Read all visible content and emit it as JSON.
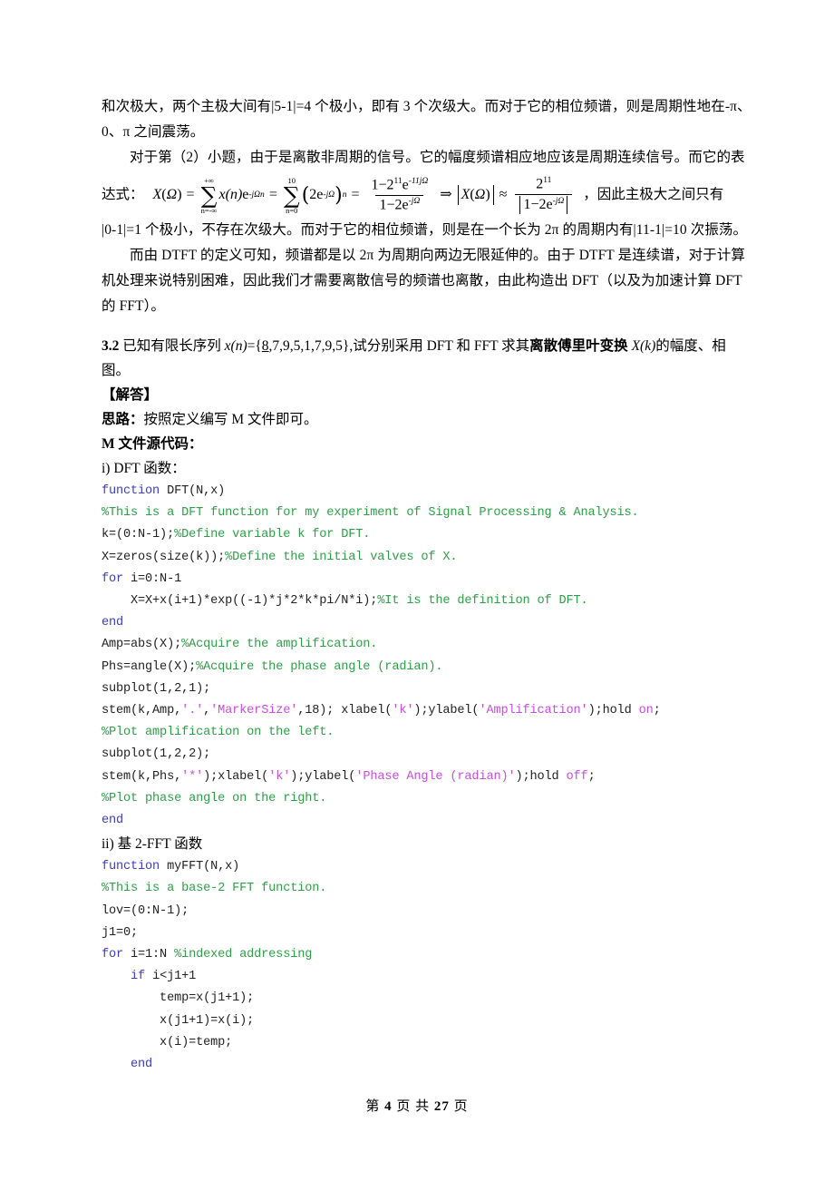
{
  "document": {
    "page_label_prefix": "第",
    "page_number": "4",
    "page_label_middle": "页 共",
    "page_total": "27",
    "page_label_suffix": "页"
  },
  "colors": {
    "keyword": "#3c3cc8",
    "comment": "#2f9e48",
    "string": "#c64fe0",
    "code_text": "#222222",
    "body_text": "#000000",
    "page_background": "#ffffff"
  },
  "prose": {
    "para1_line1": "和次极大，两个主极大间有|5-1|=4 个极小，即有 3 个次级大。而对于它的相位频谱，则是周期性地在-π、",
    "para1_line2": "0、π 之间震荡。",
    "para2_lead": "对于第（2）小题，由于是离散非周期的信号。它的幅度频谱相应地应该是周期连续信号。而它的表",
    "eq_label": "达式：",
    "after_eq": "，因此主极大之间只有",
    "para3_line1": "|0-1|=1 个极小，不存在次级大。而对于它的相位频谱，则是在一个长为 2π 的周期内有|11-1|=10 次振荡。",
    "para4_line1": "而由 DTFT 的定义可知，频谱都是以 2π 为周期向两边无限延伸的。由于 DTFT 是连续谱，对于计算",
    "para4_line2": "机处理来说特别困难，因此我们才需要离散信号的频谱也离散，由此构造出 DFT（以及为加速计算 DFT",
    "para4_line3": "的 FFT）。"
  },
  "equation": {
    "lhs_X": "X",
    "lhs_open": "(",
    "lhs_omega": "Ω",
    "lhs_close": ")",
    "equals": "=",
    "sum1_upper": "+∞",
    "sum1_sigma": "∑",
    "sum1_lower": "n=-∞",
    "term1_x": "x",
    "term1_args": "(n)",
    "term1_e": "e",
    "term1_exp": "-jΩn",
    "sum2_upper": "10",
    "sum2_sigma": "∑",
    "sum2_lower": "n=0",
    "term2_open": "(",
    "term2_two": "2e",
    "term2_exp": "-jΩ",
    "term2_close": ")",
    "term2_pow": "n",
    "frac1_num_a": "1",
    "frac1_num_minus": "−",
    "frac1_num_b": "2",
    "frac1_num_b_exp": "11",
    "frac1_num_e": "e",
    "frac1_num_e_exp": "-11jΩ",
    "frac1_den_a": "1",
    "frac1_den_minus": "−",
    "frac1_den_b": "2e",
    "frac1_den_exp": "-jΩ",
    "implies": "⇒",
    "abs_X": "X",
    "abs_open": "(",
    "abs_omega": "Ω",
    "abs_close": ")",
    "approx": "≈",
    "frac2_num": "2",
    "frac2_num_exp": "11",
    "frac2_den_a": "1",
    "frac2_den_minus": "−",
    "frac2_den_b": "2e",
    "frac2_den_exp": "-jΩ"
  },
  "problem": {
    "number": "3.2",
    "text_a": " 已知有限长序列 ",
    "var_x": "x",
    "var_n": "(n)",
    "text_b": "={",
    "seq_first": "8",
    "seq_rest": ",7,9,5,1,7,9,5",
    "text_c": "},试分别采用 DFT 和 FFT 求其",
    "bold_term": "离散傅里叶变换",
    "var_X": " X",
    "var_k": "(k)",
    "text_d": "的幅度、相",
    "line2": "图。",
    "answer_marker": "【解答】",
    "approach_label": "思路：",
    "approach_text": "按照定义编写 M 文件即可。",
    "source_heading": "M 文件源代码：",
    "dft_heading": "i) DFT 函数：",
    "fft_heading_a": "ii) 基 2-FFT 函数"
  },
  "code_dft": [
    [
      {
        "t": "function ",
        "c": "kw"
      },
      {
        "t": "DFT(N,x)",
        "c": ""
      }
    ],
    [
      {
        "t": "%This is a DFT function for my experiment of Signal Processing & Analysis.",
        "c": "cm"
      }
    ],
    [
      {
        "t": "k=(0:N-1);",
        "c": ""
      },
      {
        "t": "%Define variable k for DFT.",
        "c": "cm"
      }
    ],
    [
      {
        "t": "X=zeros(size(k));",
        "c": ""
      },
      {
        "t": "%Define the initial valves of X.",
        "c": "cm"
      }
    ],
    [
      {
        "t": "for ",
        "c": "kw"
      },
      {
        "t": "i=0:N-1",
        "c": ""
      }
    ],
    [
      {
        "t": "    X=X+x(i+1)*exp((-1)*j*2*k*pi/N*i);",
        "c": ""
      },
      {
        "t": "%It is the definition of DFT.",
        "c": "cm"
      }
    ],
    [
      {
        "t": "end",
        "c": "kw"
      }
    ],
    [
      {
        "t": "Amp=abs(X);",
        "c": ""
      },
      {
        "t": "%Acquire the amplification.",
        "c": "cm"
      }
    ],
    [
      {
        "t": "Phs=angle(X);",
        "c": ""
      },
      {
        "t": "%Acquire the phase angle (radian).",
        "c": "cm"
      }
    ],
    [
      {
        "t": "subplot(1,2,1);",
        "c": ""
      }
    ],
    [
      {
        "t": "stem(k,Amp,",
        "c": ""
      },
      {
        "t": "'.'",
        "c": "st"
      },
      {
        "t": ",",
        "c": ""
      },
      {
        "t": "'MarkerSize'",
        "c": "st"
      },
      {
        "t": ",18); xlabel(",
        "c": ""
      },
      {
        "t": "'k'",
        "c": "st"
      },
      {
        "t": ");ylabel(",
        "c": ""
      },
      {
        "t": "'Amplification'",
        "c": "st"
      },
      {
        "t": ");hold ",
        "c": ""
      },
      {
        "t": "on",
        "c": "st"
      },
      {
        "t": ";",
        "c": ""
      }
    ],
    [
      {
        "t": "%Plot amplification on the left.",
        "c": "cm"
      }
    ],
    [
      {
        "t": "subplot(1,2,2);",
        "c": ""
      }
    ],
    [
      {
        "t": "stem(k,Phs,",
        "c": ""
      },
      {
        "t": "'*'",
        "c": "st"
      },
      {
        "t": ");xlabel(",
        "c": ""
      },
      {
        "t": "'k'",
        "c": "st"
      },
      {
        "t": ");ylabel(",
        "c": ""
      },
      {
        "t": "'Phase Angle (radian)'",
        "c": "st"
      },
      {
        "t": ");hold ",
        "c": ""
      },
      {
        "t": "off",
        "c": "st"
      },
      {
        "t": ";",
        "c": ""
      }
    ],
    [
      {
        "t": "%Plot phase angle on the right.",
        "c": "cm"
      }
    ],
    [
      {
        "t": "end",
        "c": "kw"
      }
    ]
  ],
  "code_fft": [
    [
      {
        "t": "function ",
        "c": "kw"
      },
      {
        "t": "myFFT(N,x)",
        "c": ""
      }
    ],
    [
      {
        "t": "%This is a base-2 FFT function.",
        "c": "cm"
      }
    ],
    [
      {
        "t": "lov=(0:N-1);",
        "c": ""
      }
    ],
    [
      {
        "t": "j1=0;",
        "c": ""
      }
    ],
    [
      {
        "t": "for ",
        "c": "kw"
      },
      {
        "t": "i=1:N ",
        "c": ""
      },
      {
        "t": "%indexed addressing",
        "c": "cm"
      }
    ],
    [
      {
        "t": "    ",
        "c": ""
      },
      {
        "t": "if ",
        "c": "kw"
      },
      {
        "t": "i<j1+1",
        "c": ""
      }
    ],
    [
      {
        "t": "        temp=x(j1+1);",
        "c": ""
      }
    ],
    [
      {
        "t": "        x(j1+1)=x(i);",
        "c": ""
      }
    ],
    [
      {
        "t": "        x(i)=temp;",
        "c": ""
      }
    ],
    [
      {
        "t": "    ",
        "c": ""
      },
      {
        "t": "end",
        "c": "kw"
      }
    ]
  ]
}
